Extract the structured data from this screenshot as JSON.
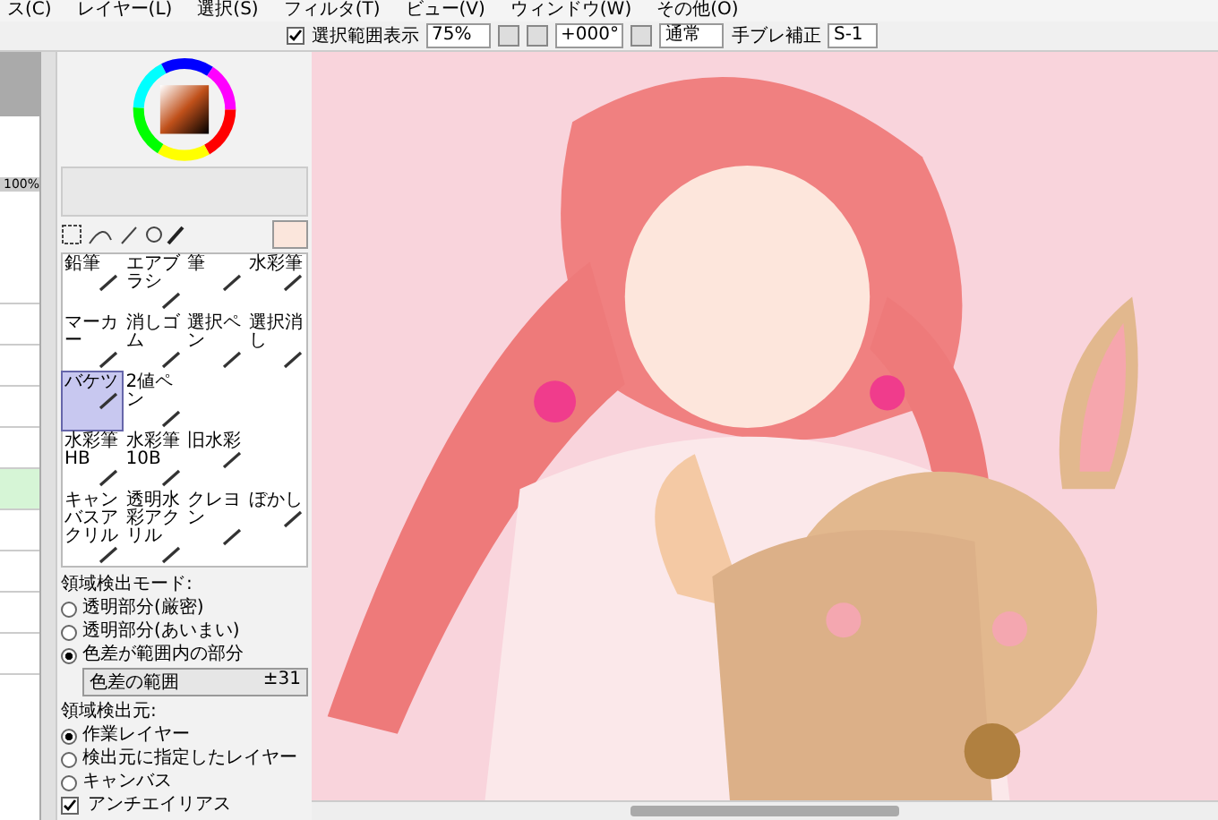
{
  "menu": [
    "ス(C)",
    "レイヤー(L)",
    "選択(S)",
    "フィルタ(T)",
    "ビュー(V)",
    "ウィンドウ(W)",
    "その他(O)"
  ],
  "toolbar": {
    "selection_visible": {
      "label": "選択範囲表示",
      "checked": true
    },
    "zoom": "75%",
    "angle": "+000°",
    "blend": "通常",
    "stabilizer_label": "手ブレ補正",
    "stabilizer": "S-1"
  },
  "layer_panel": {
    "opacity": "100%",
    "layers": [
      {
        "selected": false
      },
      {
        "selected": false
      },
      {
        "selected": false
      },
      {
        "selected": false
      },
      {
        "selected": false
      },
      {
        "selected": true
      },
      {
        "selected": false
      },
      {
        "selected": false
      },
      {
        "selected": false
      },
      {
        "selected": false
      }
    ]
  },
  "tool_rows": [
    [
      {
        "label": "鉛筆",
        "selected": false
      },
      {
        "label": "エアブラシ",
        "selected": false
      },
      {
        "label": "筆",
        "selected": false
      },
      {
        "label": "水彩筆",
        "selected": false
      }
    ],
    [
      {
        "label": "マーカー",
        "selected": false
      },
      {
        "label": "消しゴム",
        "selected": false
      },
      {
        "label": "選択ペン",
        "selected": false
      },
      {
        "label": "選択消し",
        "selected": false
      }
    ],
    [
      {
        "label": "バケツ",
        "selected": true
      },
      {
        "label": "2値ペン",
        "selected": false
      }
    ],
    [
      {
        "label": "水彩筆HB",
        "selected": false
      },
      {
        "label": "水彩筆10B",
        "selected": false
      },
      {
        "label": "旧水彩",
        "selected": false
      }
    ],
    [
      {
        "label": "キャンバスアクリル",
        "selected": false
      },
      {
        "label": "透明水彩アクリル",
        "selected": false
      },
      {
        "label": "クレヨン",
        "selected": false
      },
      {
        "label": "ぼかし",
        "selected": false
      }
    ]
  ],
  "options": {
    "mode_label": "領域検出モード:",
    "modes": [
      {
        "label": "透明部分(厳密)",
        "selected": false
      },
      {
        "label": "透明部分(あいまい)",
        "selected": false
      },
      {
        "label": "色差が範囲内の部分",
        "selected": true
      }
    ],
    "range_label": "色差の範囲",
    "range_value": "±31",
    "source_label": "領域検出元:",
    "sources": [
      {
        "label": "作業レイヤー",
        "selected": true
      },
      {
        "label": "検出元に指定したレイヤー",
        "selected": false
      },
      {
        "label": "キャンバス",
        "selected": false
      }
    ],
    "antialias": {
      "label": "アンチエイリアス",
      "checked": true
    }
  },
  "canvas": {
    "kind": "picture"
  }
}
